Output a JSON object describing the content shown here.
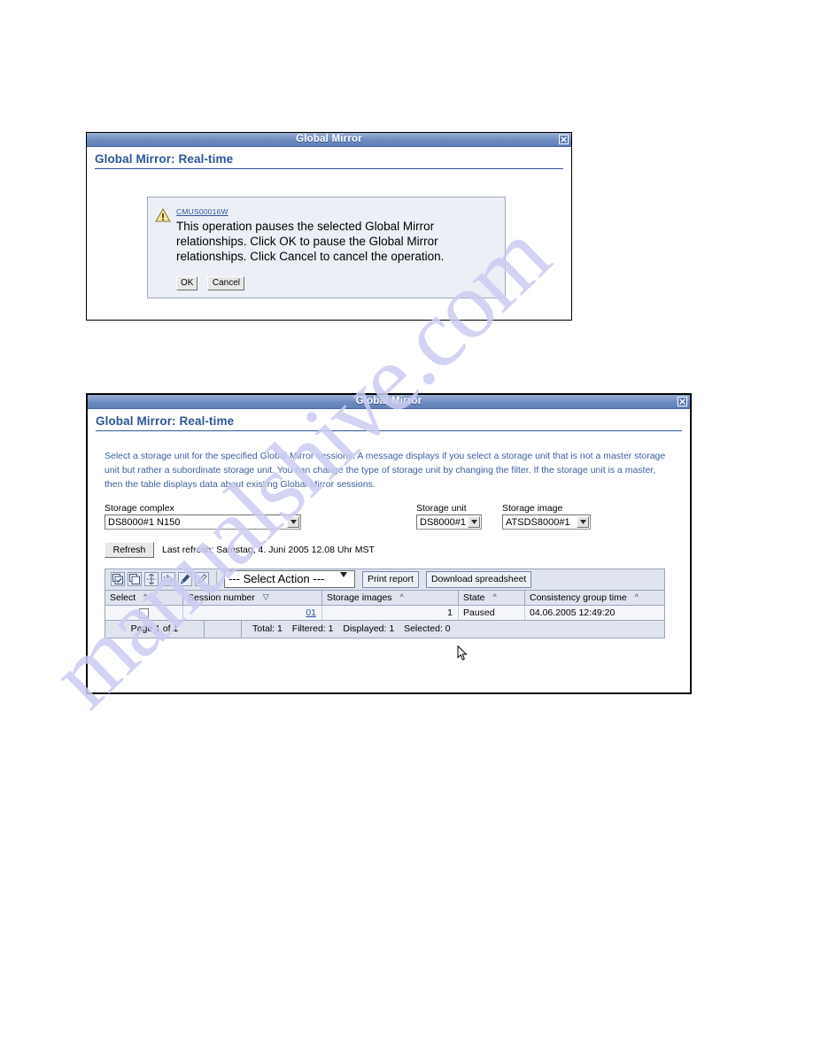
{
  "watermark": {
    "text": "manualshive.com"
  },
  "confirm_dialog": {
    "window_title": "Global Mirror",
    "close_label": "x",
    "page_heading": "Global Mirror: Real-time",
    "message_id": "CMUS00016W",
    "message_text": "This operation pauses the selected Global Mirror relationships. Click OK to pause the Global Mirror relationships. Click Cancel to cancel the operation.",
    "ok_label": "OK",
    "cancel_label": "Cancel",
    "warning_icon": "warning-triangle-icon"
  },
  "main_dialog": {
    "window_title": "Global Mirror",
    "close_label": "x",
    "page_heading": "Global Mirror: Real-time",
    "intro_text": "Select a storage unit for the specified Global Mirror sessions. A message displays if you select a storage unit that is not a master storage unit but rather a subordinate storage unit. You can change the type of storage unit by changing the filter. If the storage unit is a master, then the table displays data about existing Global Mirror sessions.",
    "filters": [
      {
        "label": "Storage complex",
        "value": "DS8000#1 N150"
      },
      {
        "label": "Storage unit",
        "value": "DS8000#1"
      },
      {
        "label": "Storage image",
        "value": "ATSDS8000#1"
      }
    ],
    "refresh": {
      "button_label": "Refresh",
      "status_text": "Last refresh: Samstag, 4. Juni 2005 12.08 Uhr MST"
    },
    "toolbar": {
      "icons": [
        "select-all-icon",
        "deselect-all-icon",
        "expand-rows-icon",
        "collapse-rows-icon",
        "edit-filter-icon",
        "clear-filter-icon"
      ],
      "action_select_value": "--- Select Action ---",
      "print_report_label": "Print report",
      "download_spreadsheet_label": "Download spreadsheet"
    },
    "table": {
      "columns": [
        {
          "label": "Select",
          "sort": "asc"
        },
        {
          "label": "Session number",
          "sort": "desc"
        },
        {
          "label": "Storage images",
          "sort": "asc"
        },
        {
          "label": "State",
          "sort": "asc"
        },
        {
          "label": "Consistency group time",
          "sort": "asc"
        }
      ],
      "rows": [
        {
          "selected": false,
          "session_number": "01",
          "storage_images": "1",
          "state": "Paused",
          "consistency_group_time": "04.06.2005 12:49:20"
        }
      ],
      "status": {
        "page": "Page 1 of 1",
        "total": "Total: 1",
        "filtered": "Filtered: 1",
        "displayed": "Displayed: 1",
        "selected": "Selected: 0"
      }
    }
  },
  "colors": {
    "titlebar_blue": "#6d8cc0",
    "heading_blue": "#2c5699",
    "intro_blue": "#3a5f9e",
    "table_header": "#dfe4ef",
    "row_bg": "#f4f6fa",
    "warning_yellow": "#f5e07a",
    "watermark": "#ccccf2"
  }
}
